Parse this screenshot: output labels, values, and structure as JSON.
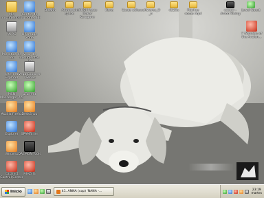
{
  "desktop": {
    "icons": [
      {
        "label": "Mis documentos",
        "icon": "folder-icon",
        "style": "folder"
      },
      {
        "label": "Centro de soluciones HP",
        "icon": "hp-solution-center-icon",
        "style": "g-blue"
      },
      {
        "label": "Mi PC",
        "icon": "my-computer-icon",
        "style": "g-gray"
      },
      {
        "label": "HP Image Zone",
        "icon": "hp-image-zone-icon",
        "style": "g-blue"
      },
      {
        "label": "Mis sitios de red",
        "icon": "network-places-icon",
        "style": "g-blue"
      },
      {
        "label": "Visor de documentos HP",
        "icon": "hp-document-viewer-icon",
        "style": "g-blue"
      },
      {
        "label": "Internet Explorer",
        "icon": "internet-explorer-icon",
        "style": "g-blue"
      },
      {
        "label": "Vega Explorer - Series",
        "icon": "vega-explorer-icon",
        "style": "g-gray"
      },
      {
        "label": "MSN Messenger 7.5",
        "icon": "msn-messenger-icon",
        "style": "g-green"
      },
      {
        "label": "µTorrent",
        "icon": "utorrent-icon",
        "style": "g-green"
      },
      {
        "label": "Mozilla Firefox",
        "icon": "firefox-icon",
        "style": "g-orange"
      },
      {
        "label": "DeskShop",
        "icon": "deskshop-icon",
        "style": "g-orange"
      },
      {
        "label": "Explorer",
        "icon": "explorer-icon",
        "style": "g-blue"
      },
      {
        "label": "SPAMfillter",
        "icon": "spamfilter-icon",
        "style": "g-red"
      },
      {
        "label": "Winamp",
        "icon": "winamp-icon",
        "style": "g-orange"
      },
      {
        "label": "DAEMON Tools",
        "icon": "daemon-tools-icon",
        "style": "g-dark"
      },
      {
        "label": "Catalyst Control Center",
        "icon": "catalyst-icon",
        "style": "g-red"
      },
      {
        "label": "FileZilla",
        "icon": "filezilla-icon",
        "style": "g-red"
      }
    ],
    "top_icons": [
      {
        "label": "Bleahh",
        "icon": "folder-icon"
      },
      {
        "label": "Anime sin space",
        "icon": "folder-icon"
      },
      {
        "label": "[AHS] Peace Maker Kurogane",
        "icon": "folder-icon"
      },
      {
        "label": "Nana",
        "icon": "folder-icon"
      },
      {
        "label": "Cosas utiles",
        "icon": "folder-icon"
      },
      {
        "label": "softwares_O_o",
        "icon": "folder-icon"
      },
      {
        "label": "d520a",
        "icon": "folder-icon"
      },
      {
        "label": "Muchas cosas Aquí",
        "icon": "folder-icon"
      },
      {
        "label": "cuccor - Amon Rising",
        "icon": "cuccor-icon"
      },
      {
        "label": "Jewel Quest",
        "icon": "jewel-quest-icon"
      }
    ],
    "right_icon": {
      "label": "7 Wonders of the Ancien...",
      "icon": "seven-wonders-icon"
    }
  },
  "taskbar": {
    "start_label": "Inicio",
    "task_label": "41. ANNA (cop) 'NANA -...",
    "clock_time": "23:19",
    "clock_day": "martes"
  }
}
